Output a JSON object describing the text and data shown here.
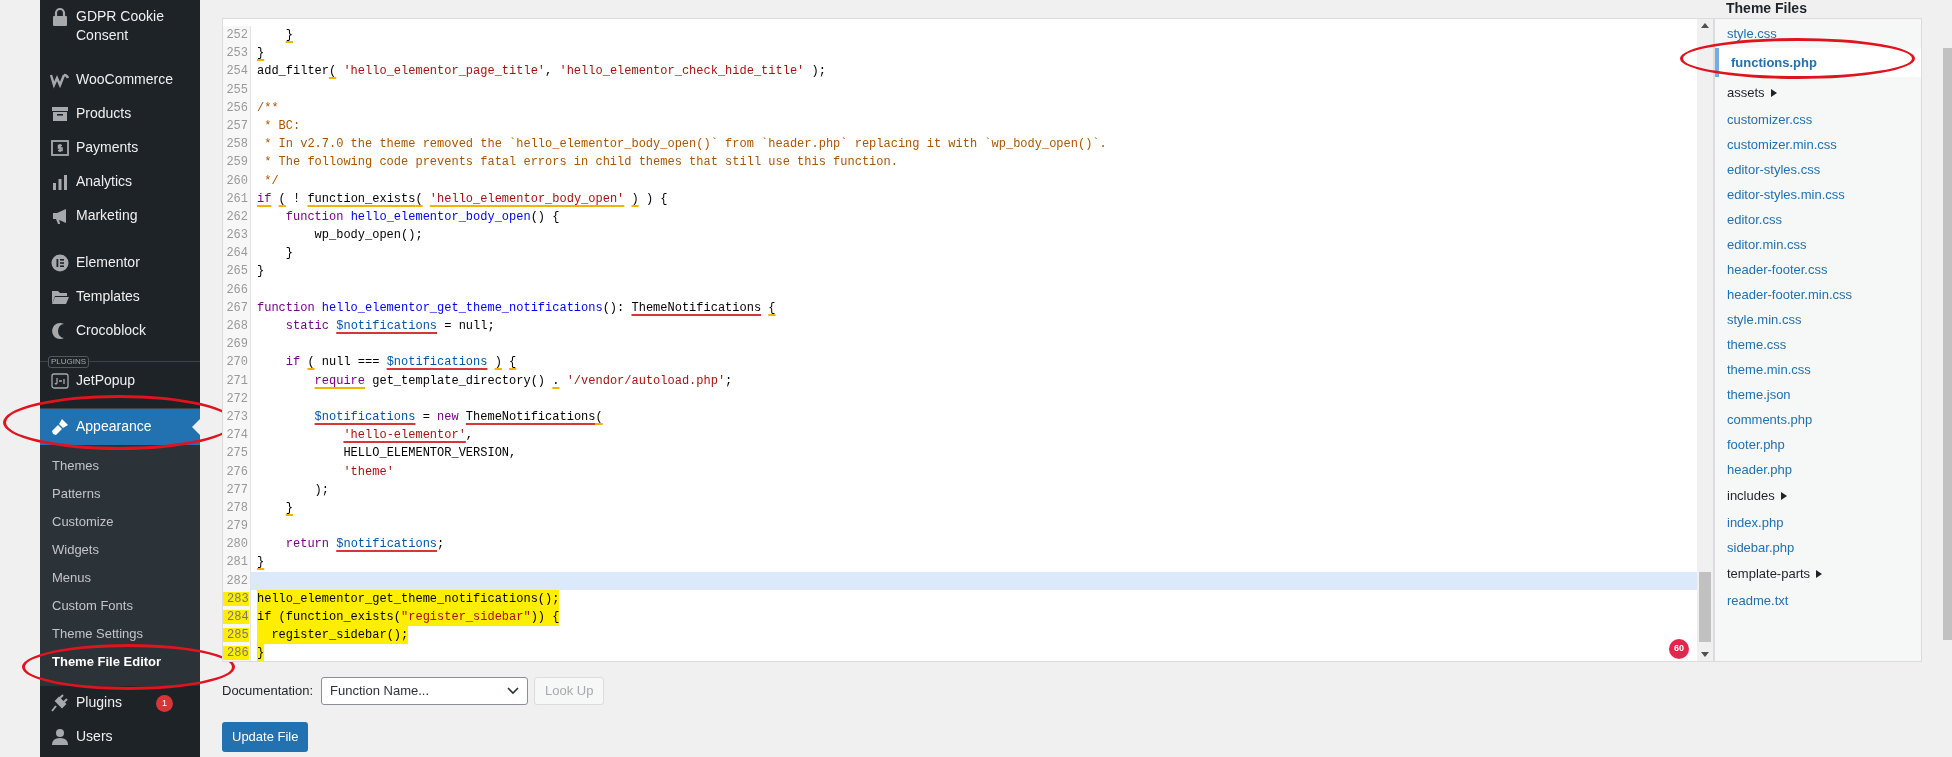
{
  "sidebar": {
    "groups": [
      {
        "items": [
          {
            "label": "GDPR Cookie Consent",
            "selected": false,
            "circled": false
          },
          {
            "label": "WooCommerce",
            "selected": false,
            "circled": false
          },
          {
            "label": "Products",
            "selected": false,
            "circled": false
          },
          {
            "label": "Payments",
            "selected": false,
            "circled": false
          },
          {
            "label": "Analytics",
            "selected": false,
            "circled": false
          },
          {
            "label": "Marketing",
            "selected": false,
            "circled": false
          }
        ]
      },
      {
        "items": [
          {
            "label": "Elementor",
            "selected": false,
            "circled": false
          },
          {
            "label": "Templates",
            "selected": false,
            "circled": false
          },
          {
            "label": "Crocoblock",
            "selected": false,
            "circled": false
          }
        ]
      },
      {
        "label": "PLUGINS",
        "items": [
          {
            "label": "JetPopup",
            "selected": false,
            "circled": false
          }
        ]
      },
      {
        "items": [
          {
            "label": "Appearance",
            "selected": true,
            "circled": true,
            "submenu": [
              {
                "label": "Themes",
                "selected": false,
                "circled": false
              },
              {
                "label": "Patterns",
                "selected": false,
                "circled": false
              },
              {
                "label": "Customize",
                "selected": false,
                "circled": false
              },
              {
                "label": "Widgets",
                "selected": false,
                "circled": false
              },
              {
                "label": "Menus",
                "selected": false,
                "circled": false
              },
              {
                "label": "Custom Fonts",
                "selected": false,
                "circled": false
              },
              {
                "label": "Theme Settings",
                "selected": false,
                "circled": false
              },
              {
                "label": "Theme File Editor",
                "selected": true,
                "circled": true
              }
            ]
          },
          {
            "label": "Plugins",
            "selected": false,
            "circled": false,
            "badge": "1"
          },
          {
            "label": "Users",
            "selected": false,
            "circled": false
          }
        ]
      }
    ]
  },
  "editor": {
    "lines": [
      {
        "number": "252",
        "active": false,
        "highlighted": false,
        "tokens": [
          {
            "text": "    }",
            "kind": "plain",
            "warning": true
          }
        ]
      },
      {
        "number": "253",
        "active": false,
        "highlighted": false,
        "tokens": [
          {
            "text": "}",
            "kind": "plain",
            "warning": true
          }
        ]
      },
      {
        "number": "254",
        "active": false,
        "highlighted": false,
        "tokens": [
          {
            "text": "add_filter",
            "kind": "plain"
          },
          {
            "text": "( ",
            "kind": "plain",
            "warning": true
          },
          {
            "text": "'hello_elementor_page_title'",
            "kind": "string"
          },
          {
            "text": ", ",
            "kind": "plain"
          },
          {
            "text": "'hello_elementor_check_hide_title'",
            "kind": "string"
          },
          {
            "text": " );",
            "kind": "plain"
          }
        ]
      },
      {
        "number": "255",
        "active": false,
        "highlighted": false
      },
      {
        "number": "256",
        "active": false,
        "highlighted": false,
        "tokens": [
          {
            "text": "/**",
            "kind": "comment"
          }
        ]
      },
      {
        "number": "257",
        "active": false,
        "highlighted": false,
        "tokens": [
          {
            "text": " * BC:",
            "kind": "comment"
          }
        ]
      },
      {
        "number": "258",
        "active": false,
        "highlighted": false,
        "tokens": [
          {
            "text": " * In v2.7.0 the theme removed the `hello_elementor_body_open()` from `header.php` replacing it with `wp_body_open()`.",
            "kind": "comment"
          }
        ]
      },
      {
        "number": "259",
        "active": false,
        "highlighted": false,
        "tokens": [
          {
            "text": " * The following code prevents fatal errors in child themes that still use this function.",
            "kind": "comment"
          }
        ]
      },
      {
        "number": "260",
        "active": false,
        "highlighted": false,
        "tokens": [
          {
            "text": " */",
            "kind": "comment"
          }
        ]
      },
      {
        "number": "261",
        "active": false,
        "highlighted": false,
        "tokens": [
          {
            "text": "if",
            "kind": "keyword",
            "warning": true
          },
          {
            "text": " (",
            "kind": "plain",
            "warning": true
          },
          {
            "text": " ! ",
            "kind": "plain"
          },
          {
            "text": "function_exists",
            "kind": "plain",
            "warning": true
          },
          {
            "text": "( ",
            "kind": "plain",
            "warning": true
          },
          {
            "text": "'hello_elementor_body_open'",
            "kind": "string",
            "warning": true
          },
          {
            "text": " )",
            "kind": "plain",
            "warning": true
          },
          {
            "text": " ) {",
            "kind": "plain"
          }
        ]
      },
      {
        "number": "262",
        "active": false,
        "highlighted": false,
        "tokens": [
          {
            "text": "    function",
            "kind": "keyword"
          },
          {
            "text": " hello_elementor_body_open",
            "kind": "definition"
          },
          {
            "text": "() {",
            "kind": "plain"
          }
        ]
      },
      {
        "number": "263",
        "active": false,
        "highlighted": false,
        "tokens": [
          {
            "text": "        wp_body_open();",
            "kind": "plain"
          }
        ]
      },
      {
        "number": "264",
        "active": false,
        "highlighted": false,
        "tokens": [
          {
            "text": "    }",
            "kind": "plain"
          }
        ]
      },
      {
        "number": "265",
        "active": false,
        "highlighted": false,
        "tokens": [
          {
            "text": "}",
            "kind": "plain"
          }
        ]
      },
      {
        "number": "266",
        "active": false,
        "highlighted": false
      },
      {
        "number": "267",
        "active": false,
        "highlighted": false,
        "tokens": [
          {
            "text": "function",
            "kind": "keyword"
          },
          {
            "text": " hello_elementor_get_theme_notifications",
            "kind": "definition"
          },
          {
            "text": "(): ",
            "kind": "plain"
          },
          {
            "text": "ThemeNotifications",
            "kind": "plain",
            "error": true
          },
          {
            "text": " {",
            "kind": "plain",
            "warning": true
          }
        ]
      },
      {
        "number": "268",
        "active": false,
        "highlighted": false,
        "tokens": [
          {
            "text": "    static",
            "kind": "keyword"
          },
          {
            "text": " $notifications",
            "kind": "variable",
            "error": true
          },
          {
            "text": " = null;",
            "kind": "plain"
          }
        ]
      },
      {
        "number": "269",
        "active": false,
        "highlighted": false
      },
      {
        "number": "270",
        "active": false,
        "highlighted": false,
        "tokens": [
          {
            "text": "    if",
            "kind": "keyword"
          },
          {
            "text": " (",
            "kind": "plain",
            "warning": true
          },
          {
            "text": " null === ",
            "kind": "plain"
          },
          {
            "text": "$notifications",
            "kind": "variable",
            "error": true
          },
          {
            "text": " )",
            "kind": "plain",
            "warning": true
          },
          {
            "text": " {",
            "kind": "plain",
            "warning": true
          }
        ]
      },
      {
        "number": "271",
        "active": false,
        "highlighted": false,
        "tokens": [
          {
            "text": "        require",
            "kind": "keyword",
            "warning": true
          },
          {
            "text": " get_template_directory() ",
            "kind": "plain"
          },
          {
            "text": ".",
            "kind": "plain",
            "warning": true
          },
          {
            "text": " '/vendor/autoload.php'",
            "kind": "string"
          },
          {
            "text": ";",
            "kind": "plain"
          }
        ]
      },
      {
        "number": "272",
        "active": false,
        "highlighted": false
      },
      {
        "number": "273",
        "active": false,
        "highlighted": false,
        "tokens": [
          {
            "text": "        $notifications",
            "kind": "variable",
            "error": true
          },
          {
            "text": " = ",
            "kind": "plain"
          },
          {
            "text": "new",
            "kind": "keyword"
          },
          {
            "text": " ThemeNotifications",
            "kind": "plain",
            "error": true
          },
          {
            "text": "(",
            "kind": "plain",
            "warning": true
          }
        ]
      },
      {
        "number": "274",
        "active": false,
        "highlighted": false,
        "tokens": [
          {
            "text": "            'hello-elementor'",
            "kind": "string",
            "error": true
          },
          {
            "text": ",",
            "kind": "plain"
          }
        ]
      },
      {
        "number": "275",
        "active": false,
        "highlighted": false,
        "tokens": [
          {
            "text": "            HELLO_ELEMENTOR_VERSION,",
            "kind": "plain"
          }
        ]
      },
      {
        "number": "276",
        "active": false,
        "highlighted": false,
        "tokens": [
          {
            "text": "            'theme'",
            "kind": "string"
          }
        ]
      },
      {
        "number": "277",
        "active": false,
        "highlighted": false,
        "tokens": [
          {
            "text": "        );",
            "kind": "plain"
          }
        ]
      },
      {
        "number": "278",
        "active": false,
        "highlighted": false,
        "tokens": [
          {
            "text": "    }",
            "kind": "plain",
            "warning": true
          }
        ]
      },
      {
        "number": "279",
        "active": false,
        "highlighted": false
      },
      {
        "number": "280",
        "active": false,
        "highlighted": false,
        "tokens": [
          {
            "text": "    return",
            "kind": "keyword"
          },
          {
            "text": " $notifications",
            "kind": "variable",
            "error": true
          },
          {
            "text": ";",
            "kind": "plain"
          }
        ]
      },
      {
        "number": "281",
        "active": false,
        "highlighted": false,
        "tokens": [
          {
            "text": "}",
            "kind": "plain",
            "warning": true
          }
        ]
      },
      {
        "number": "282",
        "active": true,
        "highlighted": false
      },
      {
        "number": "283",
        "active": false,
        "highlighted": true,
        "tokens": [
          {
            "text": "hello_elementor_get_theme_notifications();",
            "kind": "plain"
          }
        ]
      },
      {
        "number": "284",
        "active": false,
        "highlighted": true,
        "tokens": [
          {
            "text": "if (function_exists(",
            "kind": "plain"
          },
          {
            "text": "\"register_sidebar\"",
            "kind": "string"
          },
          {
            "text": ")) {",
            "kind": "plain"
          }
        ]
      },
      {
        "number": "285",
        "active": false,
        "highlighted": true,
        "tokens": [
          {
            "text": "  register_sidebar();",
            "kind": "plain"
          }
        ]
      },
      {
        "number": "286",
        "active": false,
        "highlighted": true,
        "tokens": [
          {
            "text": "}",
            "kind": "plain"
          }
        ]
      }
    ],
    "lint_badge": "60"
  },
  "documentation": {
    "label": "Documentation:",
    "select": "Function Name...",
    "lookup_button": {
      "label": "Look Up",
      "disabled": true
    }
  },
  "update_button": "Update File",
  "theme_files": {
    "title": "Theme Files",
    "items": [
      {
        "name": "style.css",
        "kind": "file",
        "selected": false,
        "circled": false
      },
      {
        "name": "functions.php",
        "kind": "file",
        "selected": true,
        "circled": true
      },
      {
        "name": "assets",
        "kind": "folder",
        "selected": false,
        "circled": false
      },
      {
        "name": "customizer.css",
        "kind": "file",
        "selected": false,
        "circled": false
      },
      {
        "name": "customizer.min.css",
        "kind": "file",
        "selected": false,
        "circled": false
      },
      {
        "name": "editor-styles.css",
        "kind": "file",
        "selected": false,
        "circled": false
      },
      {
        "name": "editor-styles.min.css",
        "kind": "file",
        "selected": false,
        "circled": false
      },
      {
        "name": "editor.css",
        "kind": "file",
        "selected": false,
        "circled": false
      },
      {
        "name": "editor.min.css",
        "kind": "file",
        "selected": false,
        "circled": false
      },
      {
        "name": "header-footer.css",
        "kind": "file",
        "selected": false,
        "circled": false
      },
      {
        "name": "header-footer.min.css",
        "kind": "file",
        "selected": false,
        "circled": false
      },
      {
        "name": "style.min.css",
        "kind": "file",
        "selected": false,
        "circled": false
      },
      {
        "name": "theme.css",
        "kind": "file",
        "selected": false,
        "circled": false
      },
      {
        "name": "theme.min.css",
        "kind": "file",
        "selected": false,
        "circled": false
      },
      {
        "name": "theme.json",
        "kind": "file",
        "selected": false,
        "circled": false
      },
      {
        "name": "comments.php",
        "kind": "file",
        "selected": false,
        "circled": false
      },
      {
        "name": "footer.php",
        "kind": "file",
        "selected": false,
        "circled": false
      },
      {
        "name": "header.php",
        "kind": "file",
        "selected": false,
        "circled": false
      },
      {
        "name": "includes",
        "kind": "folder",
        "selected": false,
        "circled": false
      },
      {
        "name": "index.php",
        "kind": "file",
        "selected": false,
        "circled": false
      },
      {
        "name": "sidebar.php",
        "kind": "file",
        "selected": false,
        "circled": false
      },
      {
        "name": "template-parts",
        "kind": "folder",
        "selected": false,
        "circled": false
      },
      {
        "name": "readme.txt",
        "kind": "file",
        "selected": false,
        "circled": false
      }
    ]
  }
}
